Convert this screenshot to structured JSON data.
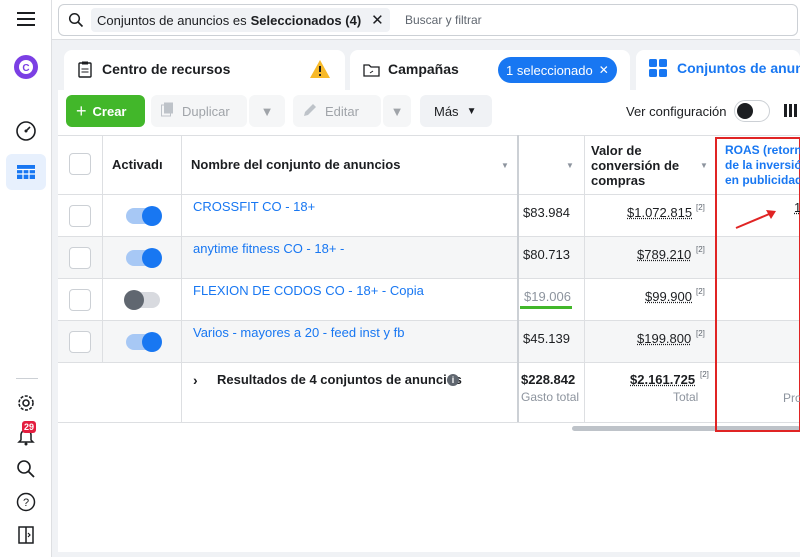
{
  "search": {
    "filter_prefix": "Conjuntos de anuncios es",
    "filter_value": "Seleccionados (4)",
    "placeholder": "Buscar y filtrar"
  },
  "tabs": {
    "resources": "Centro de recursos",
    "campaigns": "Campañas",
    "selected_pill": "1 seleccionado",
    "adsets": "Conjuntos de anun"
  },
  "toolbar": {
    "create": "Crear",
    "duplicate": "Duplicar",
    "edit": "Editar",
    "more": "Más",
    "view_config": "Ver configuración"
  },
  "table": {
    "headers": {
      "active": "Activadı",
      "name": "Nombre del conjunto de anuncios",
      "conversion_line1": "Valor de",
      "conversion_line2": "conversión de",
      "conversion_line3": "compras",
      "roas_line1": "ROAS (retorn",
      "roas_line2": "de la inversió",
      "roas_line3": "en publicidad"
    },
    "rows": [
      {
        "name": "CROSSFIT CO - 18+",
        "spend": "$83.984",
        "conversion": "$1.072.815",
        "ref": "[2]",
        "active": true
      },
      {
        "name": "anytime fitness CO - 18+ -",
        "spend": "$80.713",
        "conversion": "$789.210",
        "ref": "[2]",
        "active": true
      },
      {
        "name": "FLEXION DE CODOS CO - 18+ - Copia",
        "spend": "$19.006",
        "conversion": "$99.900",
        "ref": "[2]",
        "active": false
      },
      {
        "name": "Varios - mayores a 20 - feed inst y fb",
        "spend": "$45.139",
        "conversion": "$199.800",
        "ref": "[2]",
        "active": true
      }
    ],
    "summary": {
      "label": "Resultados de 4 conjuntos de anuncios",
      "spend": "$228.842",
      "spend_sub": "Gasto total",
      "conversion": "$2.161.725",
      "ref": "[2]",
      "conversion_sub": "Total",
      "roas_sub": "Pro"
    },
    "roas_first_value": "1"
  },
  "notifications": {
    "count": "29"
  },
  "colors": {
    "accent": "#1877f2",
    "create": "#42b72a",
    "annotation": "#e02424"
  }
}
